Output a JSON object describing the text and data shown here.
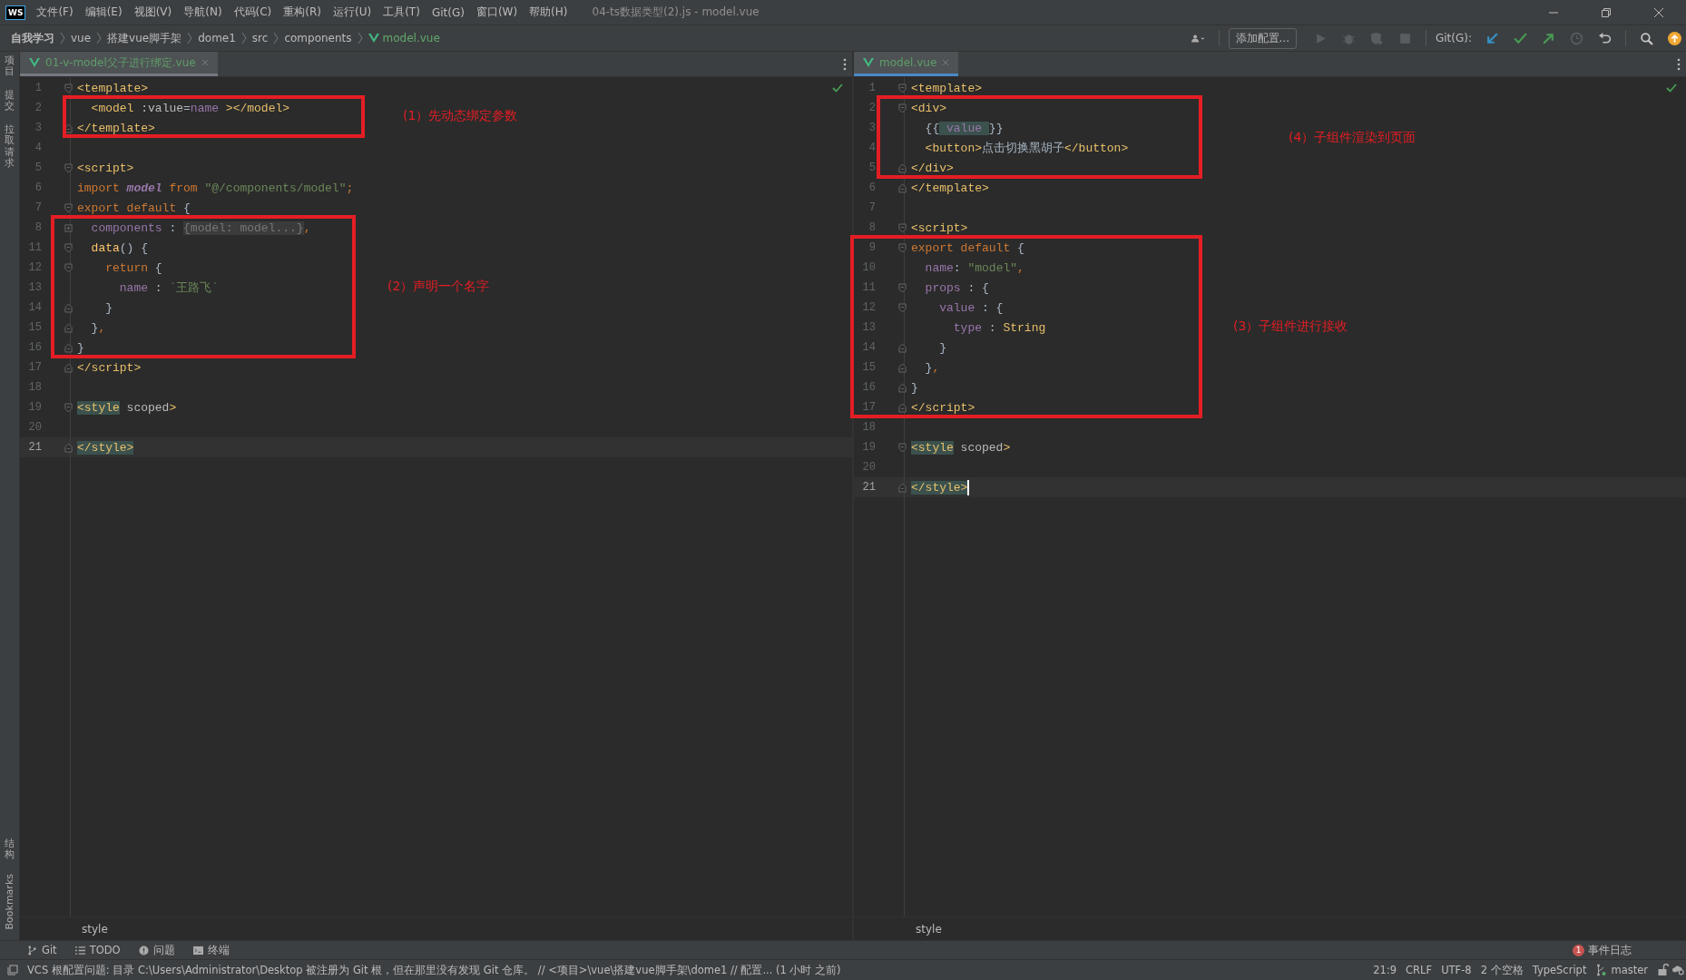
{
  "title_bar": {
    "logo": "WS",
    "menus": [
      "文件(F)",
      "编辑(E)",
      "视图(V)",
      "导航(N)",
      "代码(C)",
      "重构(R)",
      "运行(U)",
      "工具(T)",
      "Git(G)",
      "窗口(W)",
      "帮助(H)"
    ],
    "title": "04-ts数据类型(2).js - model.vue"
  },
  "nav_bar": {
    "breadcrumbs": [
      {
        "text": "自我学习",
        "kind": "project"
      },
      {
        "text": "vue",
        "kind": "folder"
      },
      {
        "text": "搭建vue脚手架",
        "kind": "folder"
      },
      {
        "text": "dome1",
        "kind": "folder"
      },
      {
        "text": "src",
        "kind": "folder"
      },
      {
        "text": "components",
        "kind": "folder"
      },
      {
        "text": "model.vue",
        "kind": "vue-file"
      }
    ],
    "add_config_button": "添加配置...",
    "git_label": "Git(G):"
  },
  "side_strip": {
    "top": [
      {
        "label": "项目",
        "kind": "cjk"
      },
      {
        "label": "提交",
        "kind": "cjk"
      },
      {
        "label": "拉取请求",
        "kind": "cjk"
      }
    ],
    "bottom": [
      {
        "label": "结构",
        "kind": "cjk"
      },
      {
        "label": "Bookmarks",
        "kind": "latin"
      }
    ]
  },
  "editors": [
    {
      "focused": false,
      "tab": {
        "label": "01-v-model父子进行绑定.vue",
        "selected": true
      },
      "breadcrumb": "style",
      "annotations": [
        "(1）先动态绑定参数",
        "(2）声明一个名字"
      ],
      "lines": [
        {
          "number": "1",
          "kind": "open",
          "current": false,
          "tokens": [
            {
              "text": "<template>",
              "kind": "tag"
            }
          ]
        },
        {
          "number": "2",
          "kind": "plain",
          "current": false,
          "tokens": [
            {
              "text": "  <model",
              "kind": "tag"
            },
            {
              "text": " :value",
              "kind": "attr"
            },
            {
              "text": "=",
              "kind": "plain"
            },
            {
              "text": "name",
              "kind": "prop"
            },
            {
              "text": " ></model>",
              "kind": "tag"
            }
          ]
        },
        {
          "number": "3",
          "kind": "close",
          "current": false,
          "tokens": [
            {
              "text": "</template>",
              "kind": "tag"
            }
          ]
        },
        {
          "number": "4",
          "kind": "plain",
          "current": false
        },
        {
          "number": "5",
          "kind": "open",
          "current": false,
          "tokens": [
            {
              "text": "<script>",
              "kind": "tag"
            }
          ]
        },
        {
          "number": "6",
          "kind": "plain",
          "current": false,
          "tokens": [
            {
              "text": "import ",
              "kind": "keyword"
            },
            {
              "text": "model",
              "kind": "ident"
            },
            {
              "text": " from ",
              "kind": "keyword"
            },
            {
              "text": "\"@/components/model\"",
              "kind": "string"
            },
            {
              "text": ";",
              "kind": "keyword"
            }
          ]
        },
        {
          "number": "7",
          "kind": "open",
          "current": false,
          "tokens": [
            {
              "text": "export default ",
              "kind": "keyword"
            },
            {
              "text": "{",
              "kind": "plain"
            }
          ]
        },
        {
          "number": "8",
          "kind": "collapsed",
          "current": false,
          "tokens": [
            {
              "text": "  components",
              "kind": "prop"
            },
            {
              "text": " : ",
              "kind": "plain"
            },
            {
              "text": "{model: model...}",
              "kind": "folded"
            },
            {
              "text": ",",
              "kind": "keyword"
            }
          ]
        },
        {
          "number": "11",
          "kind": "open",
          "current": false,
          "tokens": [
            {
              "text": "  data",
              "kind": "function"
            },
            {
              "text": "() {",
              "kind": "plain"
            }
          ]
        },
        {
          "number": "12",
          "kind": "open",
          "current": false,
          "tokens": [
            {
              "text": "    return ",
              "kind": "keyword"
            },
            {
              "text": "{",
              "kind": "plain"
            }
          ]
        },
        {
          "number": "13",
          "kind": "plain",
          "current": false,
          "tokens": [
            {
              "text": "      name",
              "kind": "prop"
            },
            {
              "text": " : ",
              "kind": "plain"
            },
            {
              "text": "`王路飞`",
              "kind": "string"
            }
          ]
        },
        {
          "number": "14",
          "kind": "close",
          "current": false,
          "tokens": [
            {
              "text": "    }",
              "kind": "plain"
            }
          ]
        },
        {
          "number": "15",
          "kind": "close",
          "current": false,
          "tokens": [
            {
              "text": "  }",
              "kind": "plain"
            },
            {
              "text": ",",
              "kind": "keyword"
            }
          ]
        },
        {
          "number": "16",
          "kind": "close",
          "current": false,
          "tokens": [
            {
              "text": "}",
              "kind": "plain"
            }
          ]
        },
        {
          "number": "17",
          "kind": "close",
          "current": false,
          "tokens": [
            {
              "text": "</script>",
              "kind": "tag"
            }
          ]
        },
        {
          "number": "18",
          "kind": "plain",
          "current": false
        },
        {
          "number": "19",
          "kind": "open",
          "current": false,
          "tokens": [
            {
              "text": "<style",
              "kind": "matched-tag"
            },
            {
              "text": " scoped",
              "kind": "attr"
            },
            {
              "text": ">",
              "kind": "tag"
            }
          ]
        },
        {
          "number": "20",
          "kind": "plain",
          "current": false
        },
        {
          "number": "21",
          "kind": "close",
          "current": true,
          "tokens": [
            {
              "text": "</style>",
              "kind": "matched-tag"
            }
          ]
        }
      ]
    },
    {
      "focused": true,
      "tab": {
        "label": "model.vue",
        "selected": true
      },
      "breadcrumb": "style",
      "annotations": [
        "(4）子组件渲染到页面",
        "(3）子组件进行接收"
      ],
      "lines": [
        {
          "number": "1",
          "kind": "open",
          "current": false,
          "tokens": [
            {
              "text": "<template>",
              "kind": "tag"
            }
          ]
        },
        {
          "number": "2",
          "kind": "open",
          "current": false,
          "tokens": [
            {
              "text": "<div>",
              "kind": "tag"
            }
          ]
        },
        {
          "number": "3",
          "kind": "plain",
          "current": false,
          "tokens": [
            {
              "text": "  {{",
              "kind": "plain"
            },
            {
              "text": " value ",
              "kind": "matched-prop"
            },
            {
              "text": "}}",
              "kind": "plain"
            }
          ]
        },
        {
          "number": "4",
          "kind": "plain",
          "current": false,
          "tokens": [
            {
              "text": "  <button>",
              "kind": "tag"
            },
            {
              "text": "点击切换黑胡子",
              "kind": "plain"
            },
            {
              "text": "</button>",
              "kind": "tag"
            }
          ]
        },
        {
          "number": "5",
          "kind": "close",
          "current": false,
          "tokens": [
            {
              "text": "</div>",
              "kind": "tag"
            }
          ]
        },
        {
          "number": "6",
          "kind": "close",
          "current": false,
          "tokens": [
            {
              "text": "</template>",
              "kind": "tag"
            }
          ]
        },
        {
          "number": "7",
          "kind": "plain",
          "current": false
        },
        {
          "number": "8",
          "kind": "open",
          "current": false,
          "tokens": [
            {
              "text": "<script>",
              "kind": "tag"
            }
          ]
        },
        {
          "number": "9",
          "kind": "open",
          "current": false,
          "tokens": [
            {
              "text": "export default ",
              "kind": "keyword"
            },
            {
              "text": "{",
              "kind": "plain"
            }
          ]
        },
        {
          "number": "10",
          "kind": "plain",
          "current": false,
          "tokens": [
            {
              "text": "  name",
              "kind": "prop"
            },
            {
              "text": ": ",
              "kind": "plain"
            },
            {
              "text": "\"model\"",
              "kind": "string"
            },
            {
              "text": ",",
              "kind": "keyword"
            }
          ]
        },
        {
          "number": "11",
          "kind": "open",
          "current": false,
          "tokens": [
            {
              "text": "  props",
              "kind": "prop"
            },
            {
              "text": " : {",
              "kind": "plain"
            }
          ]
        },
        {
          "number": "12",
          "kind": "open",
          "current": false,
          "tokens": [
            {
              "text": "    value",
              "kind": "prop"
            },
            {
              "text": " : {",
              "kind": "plain"
            }
          ]
        },
        {
          "number": "13",
          "kind": "plain",
          "current": false,
          "tokens": [
            {
              "text": "      type",
              "kind": "prop"
            },
            {
              "text": " : ",
              "kind": "plain"
            },
            {
              "text": "String",
              "kind": "class"
            }
          ]
        },
        {
          "number": "14",
          "kind": "close",
          "current": false,
          "tokens": [
            {
              "text": "    }",
              "kind": "plain"
            }
          ]
        },
        {
          "number": "15",
          "kind": "close",
          "current": false,
          "tokens": [
            {
              "text": "  }",
              "kind": "plain"
            },
            {
              "text": ",",
              "kind": "keyword"
            }
          ]
        },
        {
          "number": "16",
          "kind": "close",
          "current": false,
          "tokens": [
            {
              "text": "}",
              "kind": "plain"
            }
          ]
        },
        {
          "number": "17",
          "kind": "close",
          "current": false,
          "tokens": [
            {
              "text": "</script>",
              "kind": "tag"
            }
          ]
        },
        {
          "number": "18",
          "kind": "plain",
          "current": false
        },
        {
          "number": "19",
          "kind": "open",
          "current": false,
          "tokens": [
            {
              "text": "<style",
              "kind": "matched-tag"
            },
            {
              "text": " scoped",
              "kind": "attr"
            },
            {
              "text": ">",
              "kind": "tag"
            }
          ]
        },
        {
          "number": "20",
          "kind": "plain",
          "current": false
        },
        {
          "number": "21",
          "kind": "close",
          "current": true,
          "tokens": [
            {
              "text": "</style>",
              "kind": "matched-tag"
            }
          ]
        }
      ]
    }
  ],
  "tool_tabs": [
    {
      "label": "Git",
      "kind": "git"
    },
    {
      "label": "TODO",
      "kind": "todo"
    },
    {
      "label": "问题",
      "kind": "problems"
    },
    {
      "label": "终端",
      "kind": "terminal"
    }
  ],
  "event_log": {
    "count": "1",
    "label": "事件日志"
  },
  "status_bar": {
    "message": "VCS 根配置问题: 目录 C:\\Users\\Administrator\\Desktop 被注册为 Git 根，但在那里没有发现 Git 仓库。 // <项目>\\vue\\搭建vue脚手架\\dome1 // 配置... (1 小时 之前)",
    "position": "21:9",
    "line_separator": "CRLF",
    "encoding": "UTF-8",
    "indent": "2 个空格",
    "language": "TypeScript",
    "branch": "master"
  }
}
